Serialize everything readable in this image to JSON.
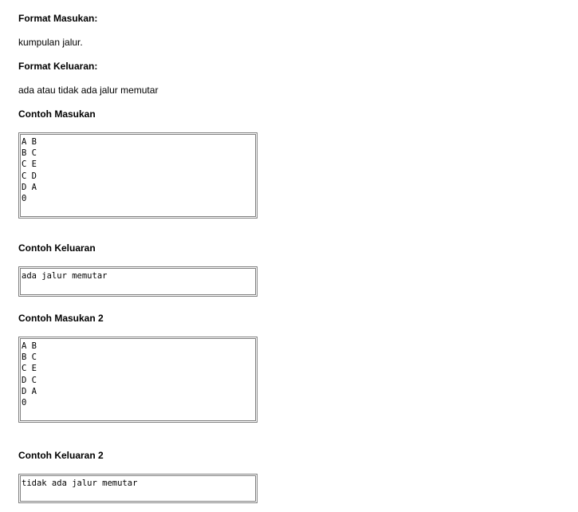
{
  "sections": {
    "format_input": {
      "heading": "Format Masukan:",
      "text": "kumpulan jalur."
    },
    "format_output": {
      "heading": "Format Keluaran:",
      "text": "ada atau tidak ada jalur memutar"
    },
    "example_input_1": {
      "heading": "Contoh Masukan",
      "lines": [
        "A B",
        "B C",
        "C E",
        "C D",
        "D A",
        "0"
      ]
    },
    "example_output_1": {
      "heading": "Contoh Keluaran",
      "lines": [
        "ada jalur memutar"
      ]
    },
    "example_input_2": {
      "heading": "Contoh Masukan 2",
      "lines": [
        "A B",
        "B C",
        "C E",
        "D C",
        "D A",
        "0"
      ]
    },
    "example_output_2": {
      "heading": "Contoh Keluaran 2",
      "lines": [
        "tidak ada jalur memutar"
      ]
    }
  }
}
